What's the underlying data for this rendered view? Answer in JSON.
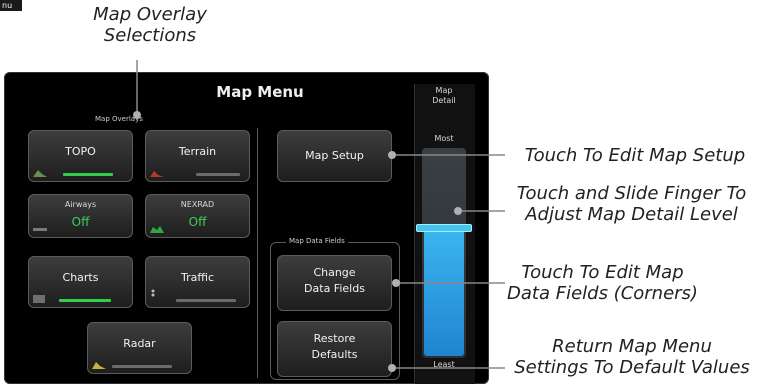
{
  "corner_tag": "nu",
  "callouts": {
    "overlay_selections": [
      "Map Overlay",
      "Selections"
    ],
    "edit_map_setup": "Touch To Edit Map Setup",
    "slide_detail": [
      "Touch and Slide Finger To",
      "Adjust Map Detail Level"
    ],
    "edit_data_fields": [
      "Touch To Edit Map",
      "Data Fields (Corners)"
    ],
    "return_defaults": [
      "Return Map Menu",
      "Settings To Default Values"
    ]
  },
  "menu": {
    "title": "Map Menu",
    "overlays_header": "Map Overlays",
    "data_fields_header": "Map Data Fields",
    "buttons": {
      "topo": "TOPO",
      "terrain": "Terrain",
      "airways_label": "Airways",
      "airways_state": "Off",
      "nexrad_label": "NEXRAD",
      "nexrad_state": "Off",
      "charts": "Charts",
      "traffic": "Traffic",
      "radar": "Radar",
      "map_setup": "Map Setup",
      "change_data_fields": [
        "Change",
        "Data Fields"
      ],
      "restore_defaults": [
        "Restore",
        "Defaults"
      ]
    },
    "detail": {
      "header": [
        "Map",
        "Detail"
      ],
      "most": "Most",
      "least": "Least",
      "level": 0.62
    }
  },
  "colors": {
    "accent_green": "#2fcf4b",
    "slider_blue": "#2aa6e8",
    "state_green": "#39d35a"
  }
}
